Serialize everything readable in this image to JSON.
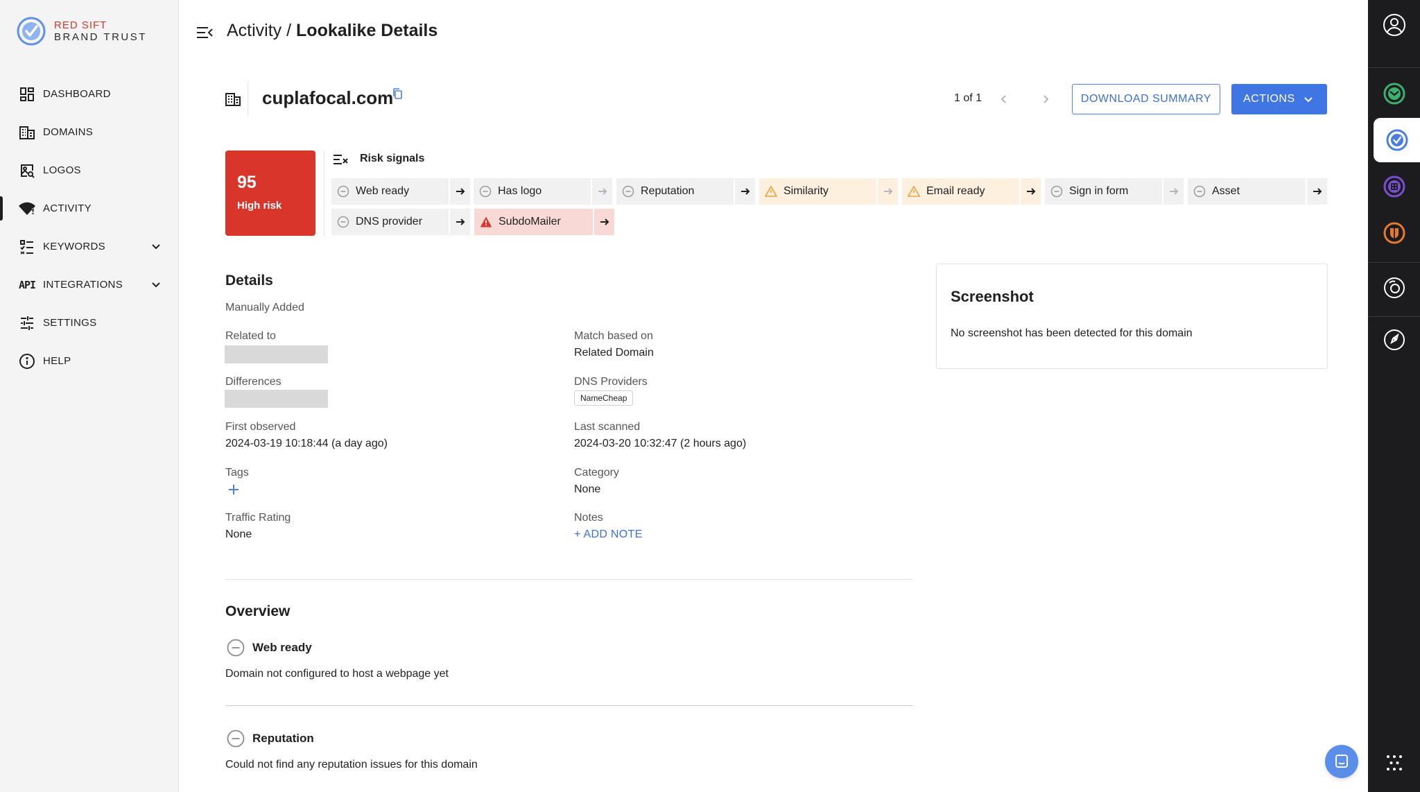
{
  "brand": {
    "line1": "RED SIFT",
    "line2": "BRAND TRUST"
  },
  "sidebar": {
    "items": [
      {
        "label": "DASHBOARD",
        "icon": "dashboard-icon"
      },
      {
        "label": "DOMAINS",
        "icon": "domains-icon"
      },
      {
        "label": "LOGOS",
        "icon": "logos-icon"
      },
      {
        "label": "ACTIVITY",
        "icon": "activity-icon",
        "active": true
      },
      {
        "label": "KEYWORDS",
        "icon": "keywords-icon",
        "expandable": true
      },
      {
        "label": "INTEGRATIONS",
        "icon": "api-icon",
        "icon_text": "API",
        "expandable": true
      },
      {
        "label": "SETTINGS",
        "icon": "settings-icon"
      },
      {
        "label": "HELP",
        "icon": "help-icon"
      }
    ]
  },
  "header": {
    "parent": "Activity",
    "separator": " / ",
    "current": "Lookalike Details"
  },
  "domain": {
    "name": "cuplafocal.com"
  },
  "pager": {
    "text": "1 of 1"
  },
  "buttons": {
    "download": "DOWNLOAD SUMMARY",
    "actions": "ACTIONS"
  },
  "risk": {
    "score": "95",
    "label": "High risk",
    "color": "#d9352b"
  },
  "signals": {
    "title": "Risk signals",
    "items": [
      {
        "label": "Web ready",
        "status": "neutral"
      },
      {
        "label": "Has logo",
        "status": "neutral",
        "arrow_dim": true
      },
      {
        "label": "Reputation",
        "status": "neutral"
      },
      {
        "label": "Similarity",
        "status": "warning",
        "arrow_dim": true
      },
      {
        "label": "Email ready",
        "status": "warning"
      },
      {
        "label": "Sign in form",
        "status": "neutral",
        "arrow_dim": true
      },
      {
        "label": "Asset",
        "status": "neutral"
      },
      {
        "label": "DNS provider",
        "status": "neutral"
      },
      {
        "label": "SubdoMailer",
        "status": "danger"
      }
    ]
  },
  "details": {
    "title": "Details",
    "source": "Manually Added",
    "related_to": {
      "label": "Related to"
    },
    "match_based_on": {
      "label": "Match based on",
      "value": "Related Domain"
    },
    "differences": {
      "label": "Differences"
    },
    "dns_providers": {
      "label": "DNS Providers",
      "tags": [
        "NameCheap"
      ]
    },
    "first_observed": {
      "label": "First observed",
      "value": "2024-03-19 10:18:44 (a day ago)"
    },
    "last_scanned": {
      "label": "Last scanned",
      "value": "2024-03-20 10:32:47 (2 hours ago)"
    },
    "tags": {
      "label": "Tags"
    },
    "category": {
      "label": "Category",
      "value": "None"
    },
    "traffic_rating": {
      "label": "Traffic Rating",
      "value": "None"
    },
    "notes": {
      "label": "Notes",
      "add": "+ ADD NOTE"
    }
  },
  "overview": {
    "title": "Overview",
    "items": [
      {
        "title": "Web ready",
        "text": "Domain not configured to host a webpage yet"
      },
      {
        "title": "Reputation",
        "text": "Could not find any reputation issues for this domain"
      }
    ]
  },
  "screenshot": {
    "title": "Screenshot",
    "text": "No screenshot has been detected for this domain"
  },
  "rail": {
    "items": [
      {
        "icon": "user-account-icon"
      },
      {
        "icon": "ondmarc-app-icon",
        "color": "#3bb16f"
      },
      {
        "icon": "brand-trust-app-icon",
        "color": "#4a7de0",
        "active": true
      },
      {
        "icon": "hardenize-app-icon",
        "color": "#7a4fd1"
      },
      {
        "icon": "certificates-app-icon",
        "color": "#e47a2c"
      },
      {
        "icon": "security-app-icon"
      },
      {
        "icon": "launch-app-icon"
      },
      {
        "icon": "app-grid-icon"
      }
    ]
  },
  "colors": {
    "accent": "#3f76e4",
    "danger": "#d9352b",
    "warning": "#e6a13b",
    "rail": "#1c1c1e"
  }
}
